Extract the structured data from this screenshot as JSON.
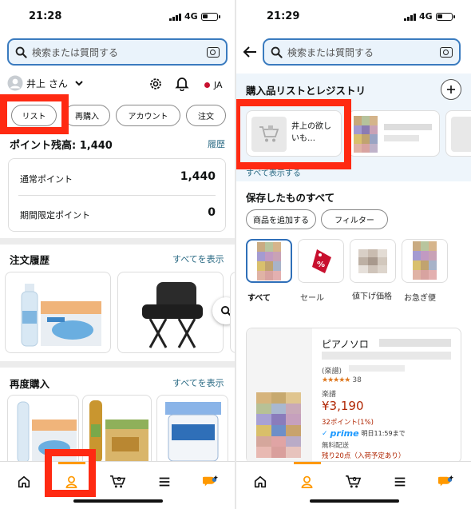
{
  "left": {
    "status": {
      "time": "21:28",
      "network": "4G"
    },
    "search": {
      "placeholder": "検索または質問する"
    },
    "user": {
      "name": "井上 さん",
      "lang": "JA"
    },
    "tabs": [
      {
        "label": "リスト"
      },
      {
        "label": "再購入"
      },
      {
        "label": "アカウント"
      },
      {
        "label": "注文"
      }
    ],
    "points": {
      "title": "ポイント残高: 1,440",
      "history": "履歴",
      "regular_label": "通常ポイント",
      "regular_value": "1,440",
      "limited_label": "期間限定ポイント",
      "limited_value": "0"
    },
    "orders": {
      "title": "注文履歴",
      "link": "すべてを表示"
    },
    "rebuy": {
      "title": "再度購入",
      "link": "すべてを表示"
    }
  },
  "right": {
    "status": {
      "time": "21:29",
      "network": "4G"
    },
    "search": {
      "placeholder": "検索または質問する"
    },
    "registry": {
      "title": "購入品リストとレジストリ",
      "list_name": "井上の欲しいも…",
      "show_all": "すべて表示する"
    },
    "saved": {
      "title": "保存したものすべて",
      "add_button": "商品を追加する",
      "filter_button": "フィルター",
      "chips": [
        {
          "label": "すべて"
        },
        {
          "label": "セール"
        },
        {
          "label": "値下げ価格"
        },
        {
          "label": "お急ぎ便"
        }
      ]
    },
    "product": {
      "title": "ピアノソロ",
      "subtitle": "(楽譜)",
      "rating_count": "38",
      "type": "楽譜",
      "price": "¥3,190",
      "points": "32ポイント(1%)",
      "prime": "prime",
      "delivery": "明日11:59まで",
      "shipping": "無料配送",
      "stock": "残り20点（入荷予定あり）"
    }
  },
  "colors": {
    "accent": "#ff9900",
    "highlight": "#ff2a12",
    "link": "#2a6a84",
    "price": "#b12704",
    "prime": "#1a98ff"
  }
}
